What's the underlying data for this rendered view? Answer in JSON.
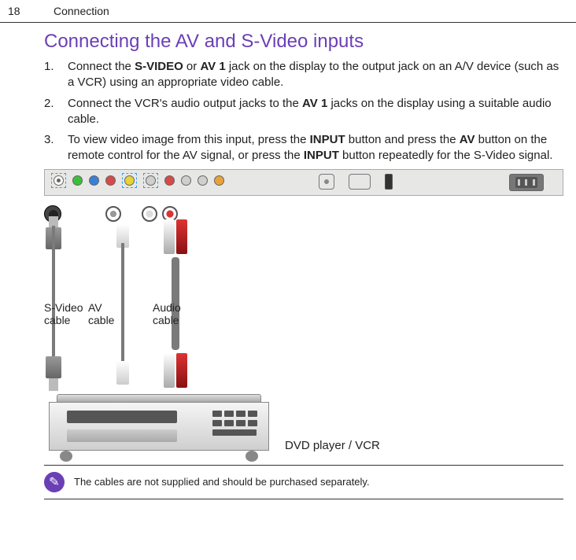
{
  "header": {
    "page_number": "18",
    "chapter": "Connection"
  },
  "section_title": "Connecting the AV and S-Video inputs",
  "steps": [
    {
      "n": "1.",
      "pre": "Connect the ",
      "bold1": "S-VIDEO",
      "mid1": " or ",
      "bold2": "AV 1",
      "post": " jack on the display to the output jack on an A/V device (such as a VCR) using an appropriate video cable."
    },
    {
      "n": "2.",
      "pre": "Connect the VCR's audio output jacks to the ",
      "bold1": "AV 1",
      "post": " jacks on the display using a suitable audio cable."
    },
    {
      "n": "3.",
      "pre": "To view video image from this input, press the ",
      "bold1": "INPUT",
      "mid1": " button and press the ",
      "bold2": "AV",
      "mid2": " button on the remote control for the AV signal, or press the ",
      "bold3": "INPUT",
      "post": " button repeatedly for the S-Video signal."
    }
  ],
  "labels": {
    "svideo_cable": "S-Video cable",
    "av_cable": "AV cable",
    "audio_cable": "Audio cable",
    "dvd_vcr": "DVD player / VCR"
  },
  "note": {
    "icon": "✎",
    "text": "The cables are not supplied and should be purchased separately."
  }
}
